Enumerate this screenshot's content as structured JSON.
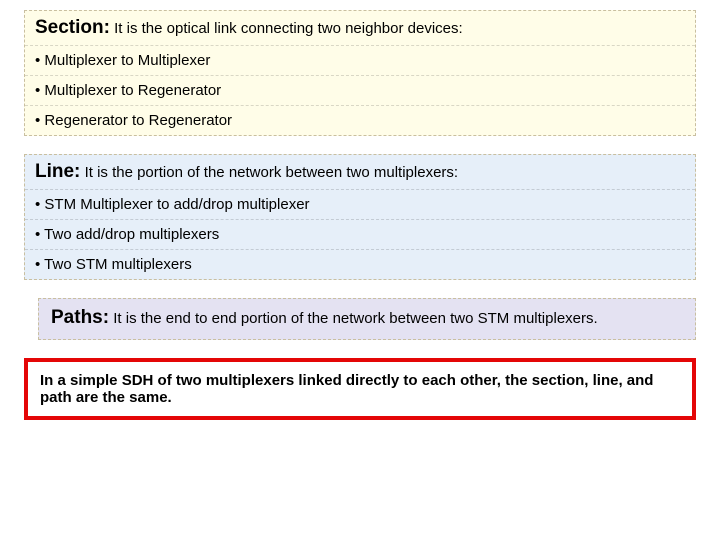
{
  "section": {
    "heading": "Section:",
    "desc": "It is the optical link connecting two neighbor devices:",
    "bullets": [
      "Multiplexer to Multiplexer",
      "Multiplexer to Regenerator",
      "Regenerator to Regenerator"
    ]
  },
  "line": {
    "heading": "Line:",
    "desc": "It is the portion of the network between two multiplexers:",
    "bullets": [
      "STM Multiplexer to add/drop multiplexer",
      "Two add/drop multiplexers",
      "Two STM multiplexers"
    ]
  },
  "paths": {
    "heading": "Paths:",
    "desc": "It is the end to end portion of the network between two STM multiplexers."
  },
  "note": "In a simple SDH of two multiplexers linked directly to each other, the section, line, and path are the same."
}
